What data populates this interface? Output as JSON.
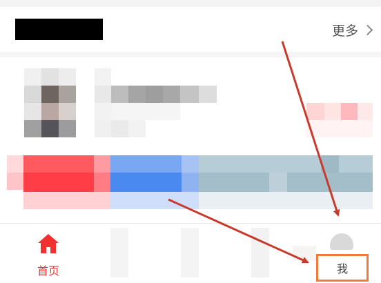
{
  "header": {
    "more_label": "更多"
  },
  "tabbar": {
    "home_label": "首页",
    "me_label": "我"
  },
  "colors": {
    "accent": "#f23030",
    "annotation_arrow": "#c83a2c",
    "highlight_box": "#f07a3c"
  },
  "icons": {
    "more": "chevron-right-icon",
    "home": "home-icon"
  }
}
